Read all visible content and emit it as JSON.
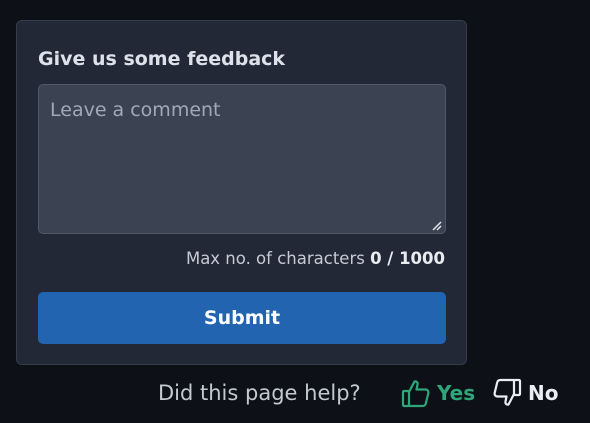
{
  "feedback": {
    "title": "Give us some feedback",
    "comment_placeholder": "Leave a comment",
    "comment_value": "",
    "char_count_label": "Max no. of characters",
    "char_count_value": "0 / 1000",
    "submit_label": "Submit"
  },
  "helpful": {
    "question": "Did this page help?",
    "yes_label": "Yes",
    "yes_icon": "thumbs-up-icon",
    "no_label": "No",
    "no_icon": "thumbs-down-icon"
  },
  "colors": {
    "background": "#0d1117",
    "card": "#222836",
    "submit": "#2264b0",
    "yes": "#2fa67a"
  }
}
